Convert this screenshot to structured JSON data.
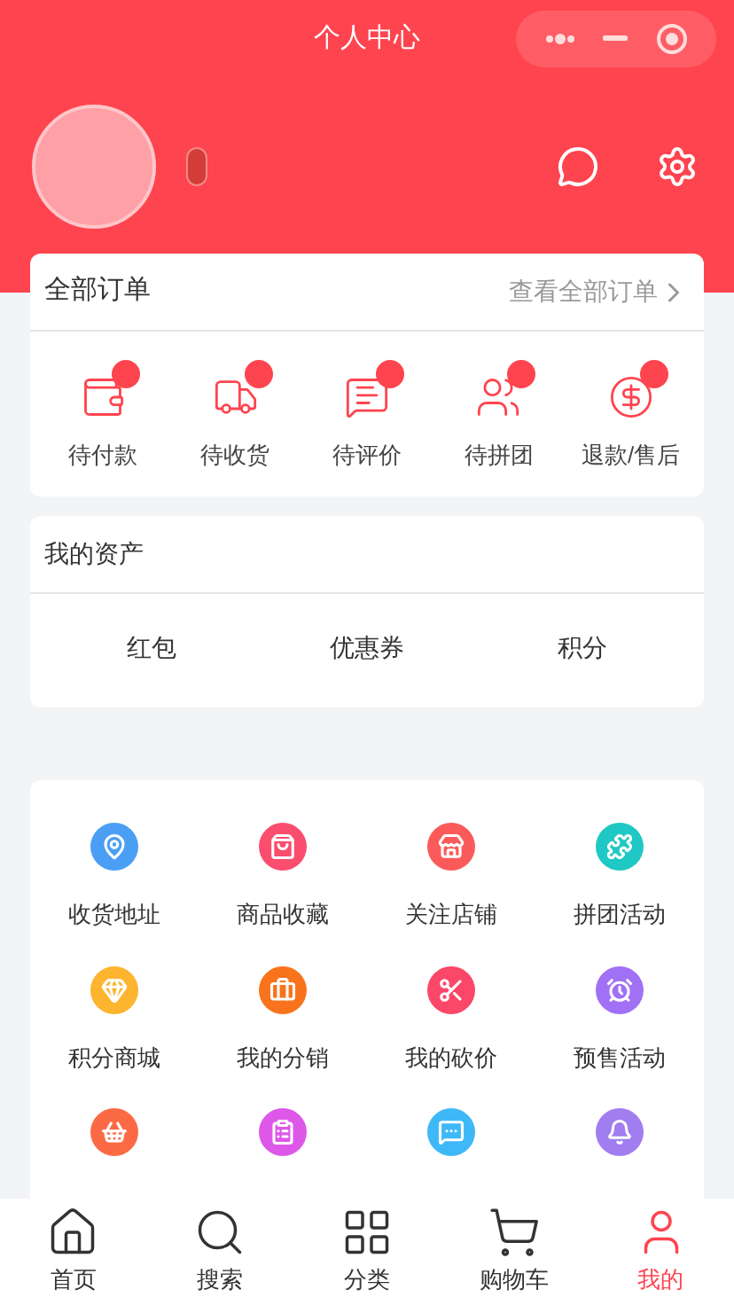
{
  "header": {
    "title": "个人中心"
  },
  "orders": {
    "title": "全部订单",
    "link": "查看全部订单",
    "items": [
      {
        "label": "待付款",
        "dot": true
      },
      {
        "label": "待收货",
        "dot": true
      },
      {
        "label": "待评价",
        "dot": true
      },
      {
        "label": "待拼团",
        "dot": true
      },
      {
        "label": "退款/售后",
        "dot": true
      }
    ]
  },
  "assets": {
    "title": "我的资产",
    "items": [
      "红包",
      "优惠券",
      "积分"
    ]
  },
  "services": [
    {
      "label": "收货地址",
      "color": "#4a9ff5"
    },
    {
      "label": "商品收藏",
      "color": "#fb4d6e"
    },
    {
      "label": "关注店铺",
      "color": "#fb5a5a"
    },
    {
      "label": "拼团活动",
      "color": "#1fc8c4"
    },
    {
      "label": "积分商城",
      "color": "#fdb42e"
    },
    {
      "label": "我的分销",
      "color": "#f8731c"
    },
    {
      "label": "我的砍价",
      "color": "#fb4768"
    },
    {
      "label": "预售活动",
      "color": "#a070f5"
    },
    {
      "color": "#fb6a45"
    },
    {
      "color": "#dd58e8"
    },
    {
      "color": "#3fb8f8"
    },
    {
      "color": "#a07ef0"
    }
  ],
  "tabs": [
    {
      "label": "首页",
      "selected": false
    },
    {
      "label": "搜索",
      "selected": false
    },
    {
      "label": "分类",
      "selected": false
    },
    {
      "label": "购物车",
      "selected": false
    },
    {
      "label": "我的",
      "selected": true
    }
  ]
}
